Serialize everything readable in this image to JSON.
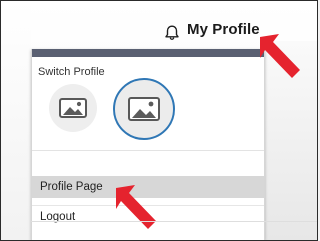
{
  "header": {
    "profile_link": "My Profile",
    "bell_icon": "bell-icon"
  },
  "menu": {
    "switch_profile_label": "Switch Profile",
    "avatars": [
      {
        "icon": "image-placeholder-icon",
        "selected": false
      },
      {
        "icon": "image-placeholder-icon",
        "selected": true
      }
    ],
    "items": [
      {
        "label": "Profile Page",
        "highlighted": true
      },
      {
        "label": "Logout",
        "highlighted": false
      }
    ]
  },
  "colors": {
    "menu_top_bar": "#5a6072",
    "selected_avatar_ring": "#2f77b5",
    "arrow": "#e5232e",
    "highlight": "#d7d7d7"
  }
}
